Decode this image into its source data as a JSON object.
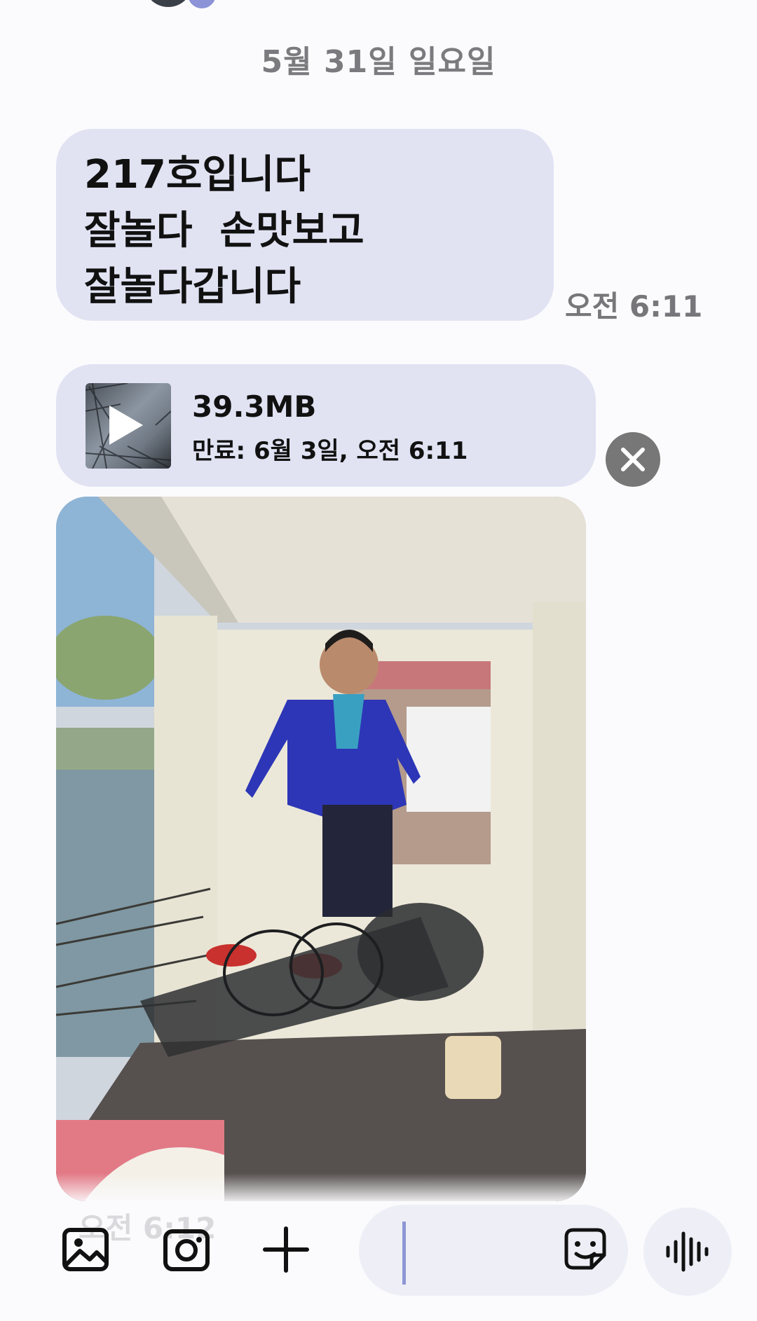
{
  "date_separator": "5월 31일 일요일",
  "text_message": {
    "lines": [
      "217호입니다",
      "잘놀다  손맛보고",
      "잘놀다갑니다"
    ],
    "time": "오전 6:11"
  },
  "video_message": {
    "size": "39.3MB",
    "expiry": "만료: 6월 3일, 오전 6:11"
  },
  "photo_message": {
    "time": "오전 6:12"
  },
  "bottom_bar": {
    "icons": [
      "gallery-icon",
      "camera-icon",
      "plus-icon",
      "sticker-icon",
      "voice-wave-icon"
    ],
    "input_value": ""
  },
  "colors": {
    "bubble": "#e1e3f3",
    "accent": "#8d97d4",
    "background": "#fbfbfd"
  }
}
